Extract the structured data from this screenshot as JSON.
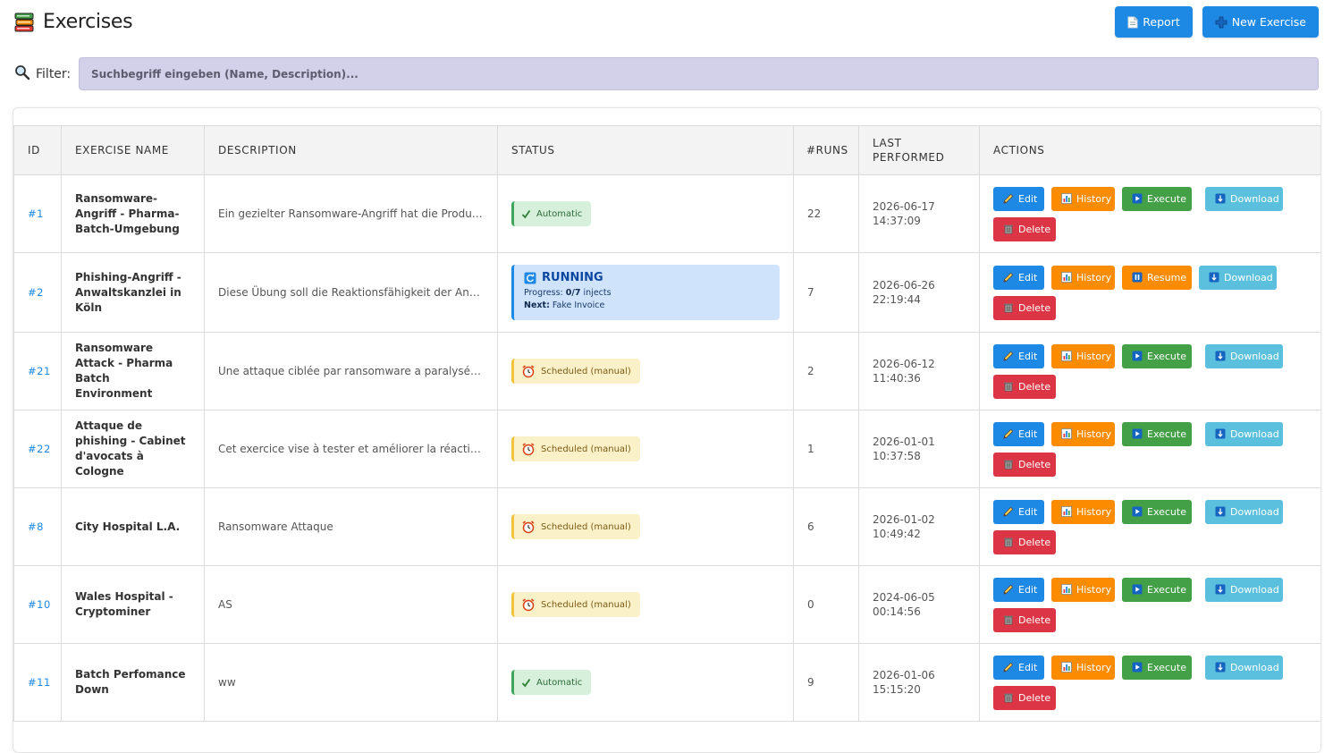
{
  "header": {
    "title": "Exercises",
    "report_label": "Report",
    "new_label": "New Exercise"
  },
  "filter": {
    "label": "Filter:",
    "placeholder": "Suchbegriff eingeben (Name, Description)..."
  },
  "table": {
    "columns": [
      "ID",
      "EXERCISE NAME",
      "DESCRIPTION",
      "STATUS",
      "#RUNS",
      "LAST PERFORMED",
      "ACTIONS"
    ],
    "rows": [
      {
        "id": "#1",
        "name": "Ransomware-Angriff - Pharma-Batch-Umgebung",
        "description": "Ein gezielter Ransomware-Angriff hat die Produktions...",
        "status": "Automatic",
        "runs": "22",
        "last": "2026-06-17 14:37:09"
      },
      {
        "id": "#2",
        "name": "Phishing-Angriff - Anwaltskanzlei in Köln",
        "description": "Diese Übung soll die Reaktionsfähigkeit der Anwaltsk...",
        "status": "RUNNING",
        "runs": "7",
        "last": "2026-06-26 22:19:44"
      },
      {
        "id": "#21",
        "name": "Ransomware Attack - Pharma Batch Environment",
        "description": "Une attaque ciblée par ransomware a paralysé les sys...",
        "status": "Scheduled (manual)",
        "runs": "2",
        "last": "2026-06-12 11:40:36"
      },
      {
        "id": "#22",
        "name": "Attaque de phishing - Cabinet d'avocats à Cologne",
        "description": "Cet exercice vise à tester et améliorer la réactivité du ...",
        "status": "Scheduled (manual)",
        "runs": "1",
        "last": "2026-01-01 10:37:58"
      },
      {
        "id": "#8",
        "name": "City Hospital L.A.",
        "description": "Ransomware Attaque",
        "status": "Scheduled (manual)",
        "runs": "6",
        "last": "2026-01-02 10:49:42"
      },
      {
        "id": "#10",
        "name": "Wales Hospital - Cryptominer",
        "description": "AS",
        "status": "Scheduled (manual)",
        "runs": "0",
        "last": "2024-06-05 00:14:56"
      },
      {
        "id": "#11",
        "name": "Batch Perfomance Down",
        "description": "ww",
        "status": "Automatic",
        "runs": "9",
        "last": "2026-01-06 15:15:20"
      }
    ],
    "running": {
      "title": "RUNNING",
      "progress_label": "Progress:",
      "progress_value": "0/7",
      "progress_unit": "injects",
      "next_label": "Next:",
      "next_value": "Fake Invoice"
    },
    "actions": {
      "edit": "Edit",
      "history": "History",
      "execute": "Execute",
      "resume": "Resume",
      "download": "Download",
      "delete": "Delete"
    }
  },
  "colors": {
    "primary": "#1e88e5",
    "history": "#fb8c00",
    "execute": "#43a047",
    "download": "#5bc0de",
    "delete": "#dc3545",
    "filter_bg": "#d3d0ea"
  },
  "icons": {
    "title": "books-icon",
    "report": "document-icon",
    "new": "plus-icon",
    "filter": "magnifier-icon",
    "automatic": "check-icon",
    "scheduled": "alarm-clock-icon",
    "running": "refresh-icon",
    "edit": "pencil-icon",
    "history": "bar-chart-icon",
    "execute": "play-icon",
    "resume": "pause-icon",
    "download": "download-icon",
    "delete": "trash-icon"
  }
}
